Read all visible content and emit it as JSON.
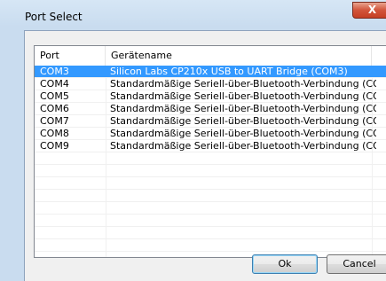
{
  "window": {
    "title": "Port Select",
    "close_label": "X"
  },
  "table": {
    "columns": [
      "Port",
      "Gerätename"
    ],
    "rows": [
      {
        "port": "COM3",
        "name": "Silicon Labs CP210x USB to UART Bridge (COM3)",
        "selected": true
      },
      {
        "port": "COM4",
        "name": "Standardmäßige Seriell-über-Bluetooth-Verbindung (CO...",
        "selected": false
      },
      {
        "port": "COM5",
        "name": "Standardmäßige Seriell-über-Bluetooth-Verbindung (CO...",
        "selected": false
      },
      {
        "port": "COM6",
        "name": "Standardmäßige Seriell-über-Bluetooth-Verbindung (CO...",
        "selected": false
      },
      {
        "port": "COM7",
        "name": "Standardmäßige Seriell-über-Bluetooth-Verbindung (CO...",
        "selected": false
      },
      {
        "port": "COM8",
        "name": "Standardmäßige Seriell-über-Bluetooth-Verbindung (CO...",
        "selected": false
      },
      {
        "port": "COM9",
        "name": "Standardmäßige Seriell-über-Bluetooth-Verbindung (CO...",
        "selected": false
      }
    ]
  },
  "buttons": {
    "ok_label": "Ok",
    "cancel_label": "Cancel"
  },
  "colors": {
    "selection": "#3399ff",
    "close_button": "#c53f24"
  }
}
